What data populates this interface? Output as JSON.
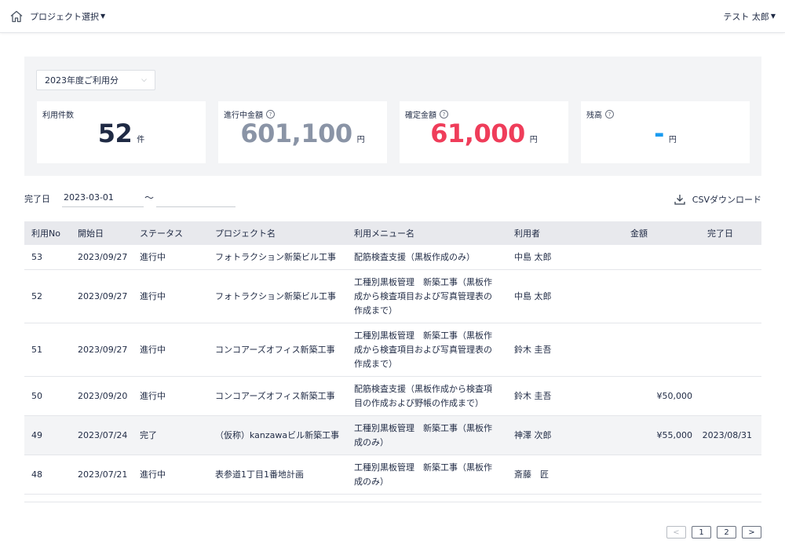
{
  "header": {
    "project_select_label": "プロジェクト選択",
    "user_name": "テスト 太郎"
  },
  "summary": {
    "year_select": "2023年度ご利用分",
    "cards": [
      {
        "label": "利用件数",
        "value": "52",
        "unit": "件",
        "color": "#1f2a44",
        "help": false
      },
      {
        "label": "進行中金額",
        "value": "601,100",
        "unit": "円",
        "color": "#8a94a6",
        "help": true
      },
      {
        "label": "確定金額",
        "value": "61,000",
        "unit": "円",
        "color": "#ef3d5a",
        "help": true
      },
      {
        "label": "残高",
        "value": "-",
        "unit": "円",
        "color": "#1a9bf0",
        "help": true
      }
    ]
  },
  "filter": {
    "label": "完了日",
    "from_value": "2023-03-01",
    "tilde": "〜",
    "to_value": "",
    "csv_label": "CSVダウンロード"
  },
  "table": {
    "headers": [
      "利用No",
      "開始日",
      "ステータス",
      "プロジェクト名",
      "利用メニュー名",
      "利用者",
      "金額",
      "完了日"
    ],
    "rows": [
      {
        "no": "53",
        "start": "2023/09/27",
        "status": "進行中",
        "project": "フォトラクション新築ビル工事",
        "menu": "配筋検査支援（黒板作成のみ）",
        "user": "中島 太郎",
        "amount": "",
        "done": ""
      },
      {
        "no": "52",
        "start": "2023/09/27",
        "status": "進行中",
        "project": "フォトラクション新築ビル工事",
        "menu": "工種別黒板管理　新築工事（黒板作成から検査項目および写真管理表の作成まで）",
        "user": "中島 太郎",
        "amount": "",
        "done": ""
      },
      {
        "no": "51",
        "start": "2023/09/27",
        "status": "進行中",
        "project": "コンコアーズオフィス新築工事",
        "menu": "工種別黒板管理　新築工事（黒板作成から検査項目および写真管理表の作成まで）",
        "user": "鈴木 圭吾",
        "amount": "",
        "done": ""
      },
      {
        "no": "50",
        "start": "2023/09/20",
        "status": "進行中",
        "project": "コンコアーズオフィス新築工事",
        "menu": "配筋検査支援（黒板作成から検査項目の作成および野帳の作成まで）",
        "user": "鈴木 圭吾",
        "amount": "¥50,000",
        "done": ""
      },
      {
        "no": "49",
        "start": "2023/07/24",
        "status": "完了",
        "project": "（仮称）kanzawaビル新築工事",
        "menu": "工種別黒板管理　新築工事（黒板作成のみ）",
        "user": "神澤 次郎",
        "amount": "¥55,000",
        "done": "2023/08/31"
      },
      {
        "no": "48",
        "start": "2023/07/21",
        "status": "進行中",
        "project": "表参道1丁目1番地計画",
        "menu": "工種別黒板管理　新築工事（黒板作成のみ）",
        "user": "斎藤　匠",
        "amount": "",
        "done": ""
      }
    ]
  },
  "pager": {
    "prev": "<",
    "pages": [
      "1",
      "2"
    ],
    "next": ">"
  }
}
